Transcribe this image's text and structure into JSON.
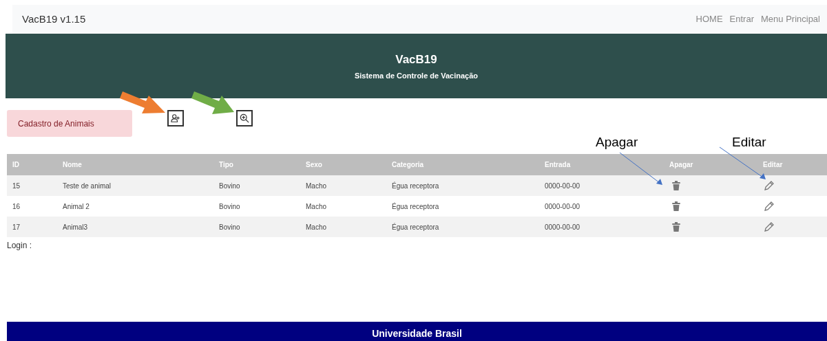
{
  "navbar": {
    "brand": "VacB19 v1.15",
    "links": [
      "HOME",
      "Entrar",
      "Menu Principal"
    ]
  },
  "header": {
    "title": "VacB19",
    "subtitle": "Sistema de Controle de Vacinação"
  },
  "alert": "Cadastro de Animais",
  "annotations": [
    {
      "kind": "orange"
    },
    {
      "kind": "green"
    },
    {
      "kind": "blue",
      "text": "Apagar"
    },
    {
      "kind": "blue",
      "text": "Editar"
    }
  ],
  "table": {
    "columns": [
      "ID",
      "Nome",
      "Tipo",
      "Sexo",
      "Categoria",
      "Entrada",
      "Apagar",
      "Editar"
    ],
    "rows": [
      {
        "cells": [
          "15",
          "Teste de animal",
          "Bovino",
          "Macho",
          "Égua receptora",
          "0000-00-00"
        ]
      },
      {
        "cells": [
          "16",
          "Animal 2",
          "Bovino",
          "Macho",
          "Égua receptora",
          "0000-00-00"
        ]
      },
      {
        "cells": [
          "17",
          "Animal3",
          "Bovino",
          "Macho",
          "Égua receptora",
          "0000-00-00"
        ]
      }
    ]
  },
  "login_label": "Login :",
  "footer": "Universidade Brasil"
}
